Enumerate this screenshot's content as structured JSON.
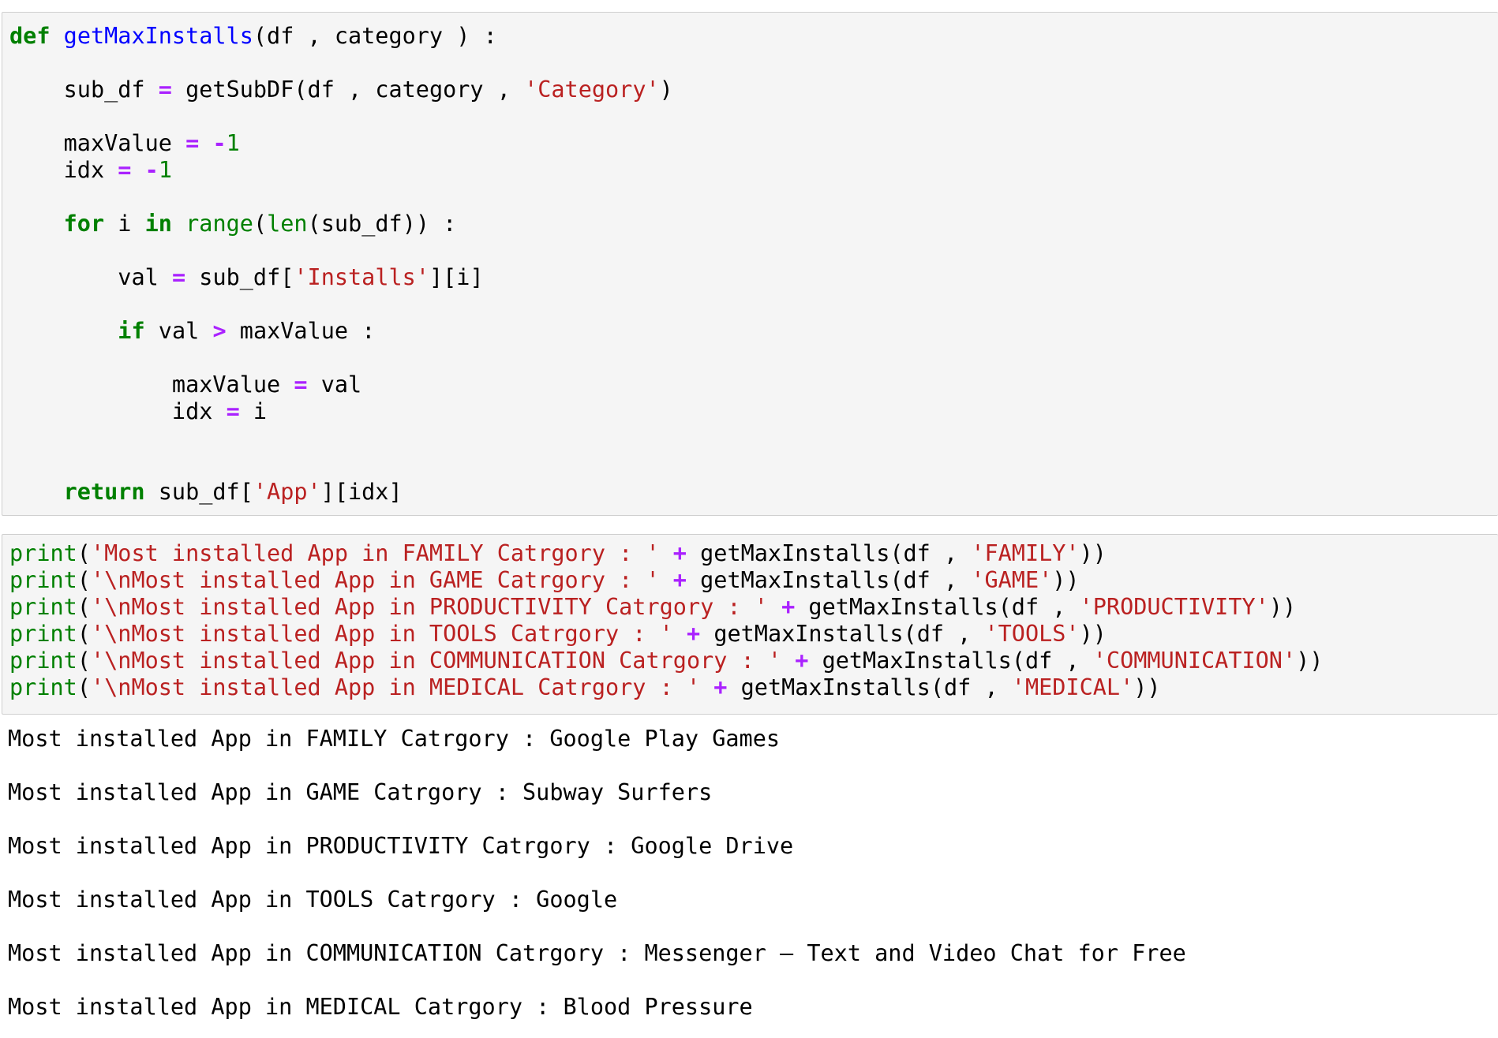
{
  "cell1": {
    "lines": [
      {
        "kw_def": "def",
        "fn": "getMaxInstalls",
        "rest": "(df , category ) :"
      },
      {
        "a": "sub_df",
        "op": "=",
        "b": "getSubDF(df , category , ",
        "str": "'Category'",
        "c": ")"
      },
      {
        "a": "maxValue",
        "op": "=",
        "neg": "-",
        "num": "1"
      },
      {
        "a": "idx",
        "op": "=",
        "neg": "-",
        "num": "1"
      },
      {
        "kw_for": "for",
        "a": "i",
        "kw_in": "in",
        "range": "range",
        "p1": "(",
        "len": "len",
        "b": "(sub_df)) :"
      },
      {
        "a": "val",
        "op": "=",
        "b": "sub_df[",
        "str": "'Installs'",
        "c": "][i]"
      },
      {
        "kw_if": "if",
        "a": "val",
        "op": ">",
        "b": "maxValue :"
      },
      {
        "a": "maxValue",
        "op": "=",
        "b": "val"
      },
      {
        "a": "idx",
        "op": "=",
        "b": "i"
      },
      {
        "kw_return": "return",
        "b": "sub_df[",
        "str": "'App'",
        "c": "][idx]"
      }
    ]
  },
  "cell2": {
    "lines": [
      {
        "print": "print",
        "p": "(",
        "str": "'Most installed App in FAMILY Catrgory : '",
        "op": "+",
        "call": "getMaxInstalls(df , ",
        "arg": "'FAMILY'",
        "end": "))"
      },
      {
        "print": "print",
        "p": "(",
        "str": "'\\nMost installed App in GAME Catrgory : '",
        "op": "+",
        "call": "getMaxInstalls(df , ",
        "arg": "'GAME'",
        "end": "))"
      },
      {
        "print": "print",
        "p": "(",
        "str": "'\\nMost installed App in PRODUCTIVITY Catrgory : '",
        "op": "+",
        "call": "getMaxInstalls(df , ",
        "arg": "'PRODUCTIVITY'",
        "end": "))"
      },
      {
        "print": "print",
        "p": "(",
        "str": "'\\nMost installed App in TOOLS Catrgory : '",
        "op": "+",
        "call": "getMaxInstalls(df , ",
        "arg": "'TOOLS'",
        "end": "))"
      },
      {
        "print": "print",
        "p": "(",
        "str": "'\\nMost installed App in COMMUNICATION Catrgory : '",
        "op": "+",
        "call": "getMaxInstalls(df , ",
        "arg": "'COMMUNICATION'",
        "end": "))"
      },
      {
        "print": "print",
        "p": "(",
        "str": "'\\nMost installed App in MEDICAL Catrgory : '",
        "op": "+",
        "call": "getMaxInstalls(df , ",
        "arg": "'MEDICAL'",
        "end": "))"
      }
    ]
  },
  "output": {
    "lines": [
      "Most installed App in FAMILY Catrgory : Google Play Games",
      "Most installed App in GAME Catrgory : Subway Surfers",
      "Most installed App in PRODUCTIVITY Catrgory : Google Drive",
      "Most installed App in TOOLS Catrgory : Google",
      "Most installed App in COMMUNICATION Catrgory : Messenger – Text and Video Chat for Free",
      "Most installed App in MEDICAL Catrgory : Blood Pressure"
    ]
  },
  "colors": {
    "cell_background": "#f5f5f5",
    "cell_border": "#cfcfcf",
    "keyword": "#008000",
    "function_name": "#0000ff",
    "string": "#ba2121",
    "operator": "#aa22ff"
  }
}
